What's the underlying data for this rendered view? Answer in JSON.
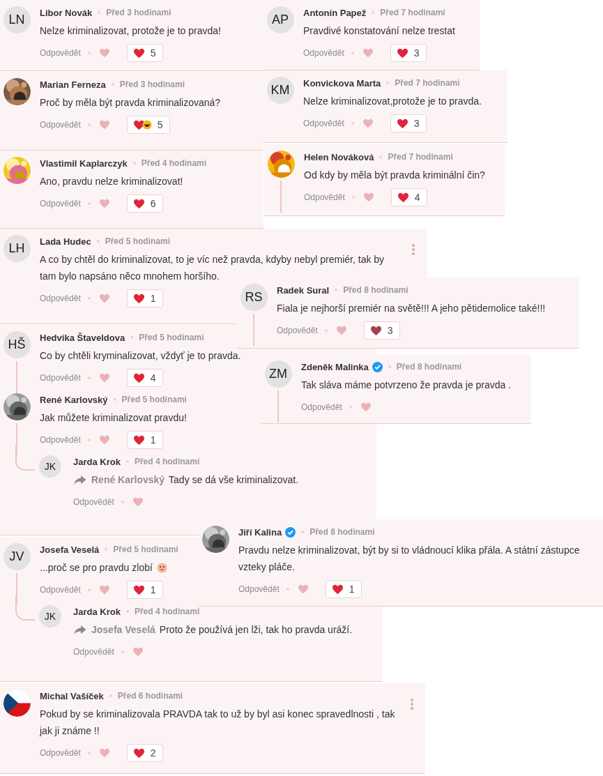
{
  "cards": [
    {
      "comments": [
        {
          "author": "Libor Novák",
          "avatar": {
            "kind": "initials",
            "initials": "LN"
          },
          "time": "Před 3 hodinami",
          "text": "Nelze kriminalizovat, protože je to pravda!",
          "reply_label": "Odpovědět",
          "likes": "5"
        }
      ]
    },
    {
      "comments": [
        {
          "author": "Marian Ferneza",
          "avatar": {
            "kind": "picture"
          },
          "time": "Před 3 hodinami",
          "text": "Proč by měla být pravda kriminalizovaná?",
          "reply_label": "Odpovědět",
          "likes": "5",
          "laugh_reaction": true
        }
      ]
    },
    {
      "comments": [
        {
          "author": "Vlastimil Kaplarczyk",
          "avatar": {
            "kind": "picture"
          },
          "time": "Před 4 hodinami",
          "text": "Ano, pravdu nelze kriminalizovat!",
          "reply_label": "Odpovědět",
          "likes": "6"
        }
      ]
    },
    {
      "comments": [
        {
          "author": "Antonín Papež",
          "avatar": {
            "kind": "initials",
            "initials": "AP"
          },
          "time": "Před 7 hodinami",
          "text": "Pravdivé konstatování nelze trestat",
          "reply_label": "Odpovědět",
          "likes": "3"
        }
      ]
    },
    {
      "comments": [
        {
          "author": "Konvickova Marta",
          "avatar": {
            "kind": "initials",
            "initials": "KM"
          },
          "time": "Před 7 hodinami",
          "text": "Nelze kriminalizovat,protože je to pravda.",
          "reply_label": "Odpovědět",
          "likes": "3"
        }
      ]
    },
    {
      "comments": [
        {
          "author": "Helen Nováková",
          "avatar": {
            "kind": "picture"
          },
          "time": "Před 7 hodinami",
          "text": "Od kdy by měla být pravda kriminální čin?",
          "reply_label": "Odpovědět",
          "likes": "4",
          "thread_line": true
        }
      ]
    },
    {
      "comments": [
        {
          "author": "Lada Hudec",
          "avatar": {
            "kind": "initials",
            "initials": "LH"
          },
          "time": "Před 5 hodinami",
          "text": "A co by chtěl do kriminalizovat, to je víc než pravda, kdyby nebyl premiér, tak by tam bylo napsáno něco mnohem horšího.",
          "reply_label": "Odpovědět",
          "likes": "1",
          "menu": true
        }
      ]
    },
    {
      "comments": [
        {
          "author": "Radek Sural",
          "avatar": {
            "kind": "initials",
            "initials": "RS"
          },
          "time": "Před 8 hodinami",
          "text": "Fiala je nejhorší premiér na světě!!! A jeho pětidemolice také!!!",
          "reply_label": "Odpovědět",
          "likes": "3",
          "dark_heart": true,
          "thread_line": true
        }
      ]
    },
    {
      "comments": [
        {
          "author": "Hedvika Štaveldova",
          "avatar": {
            "kind": "initials",
            "initials": "HŠ"
          },
          "time": "Před 5 hodinami",
          "text": "Co by chtěli kryminalizovat, vždyť je to pravda.",
          "reply_label": "Odpovědět",
          "likes": "4",
          "thread_line": true
        },
        {
          "author": "René Karlovský",
          "avatar": {
            "kind": "picture"
          },
          "time": "Před 5 hodinami",
          "text": "Jak můžete kriminalizovat pravdu!",
          "reply_label": "Odpovědět",
          "likes": "1",
          "replies": [
            {
              "author": "Jarda Krok",
              "avatar": {
                "kind": "initials",
                "initials": "JK"
              },
              "time": "Před 4 hodinami",
              "reply_to": "René Karlovský",
              "text": "Tady se dá vše kriminalizovat.",
              "reply_label": "Odpovědět"
            }
          ]
        }
      ]
    },
    {
      "comments": [
        {
          "author": "Zdeněk Malinka",
          "avatar": {
            "kind": "initials",
            "initials": "ZM"
          },
          "verified": true,
          "time": "Před 8 hodinami",
          "text": "Tak sláva máme potvrzeno že pravda je pravda .",
          "reply_label": "Odpovědět",
          "thread_line": true
        }
      ]
    },
    {
      "comments": [
        {
          "author": "Josefa Veselá",
          "avatar": {
            "kind": "initials",
            "initials": "JV"
          },
          "time": "Před 5 hodinami",
          "text": "...proč se pro pravdu zlobí",
          "emoji": true,
          "reply_label": "Odpovědět",
          "likes": "1",
          "replies": [
            {
              "author": "Jarda Krok",
              "avatar": {
                "kind": "initials",
                "initials": "JK"
              },
              "time": "Před 4 hodinami",
              "reply_to": "Josefa Veselá",
              "text": "Proto že používá jen lži, tak ho pravda uráží.",
              "reply_label": "Odpovědět"
            }
          ]
        }
      ]
    },
    {
      "comments": [
        {
          "author": "Jiří Kalina",
          "avatar": {
            "kind": "picture"
          },
          "verified": true,
          "time": "Před 8 hodinami",
          "text": "Pravdu nelze kriminalizovat, být by si to vládnoucí klika přála. A státní zástupce vzteky pláče.",
          "reply_label": "Odpovědět",
          "likes": "1"
        }
      ]
    },
    {
      "comments": [
        {
          "author": "Michal Vašíček",
          "avatar": {
            "kind": "flag"
          },
          "time": "Před 6 hodinami",
          "text": "Pokud by se kriminalizovala PRAVDA tak to už by byl asi konec spravedlnosti , tak jak ji známe !!",
          "reply_label": "Odpovědět",
          "likes": "2",
          "menu": true
        }
      ]
    }
  ]
}
